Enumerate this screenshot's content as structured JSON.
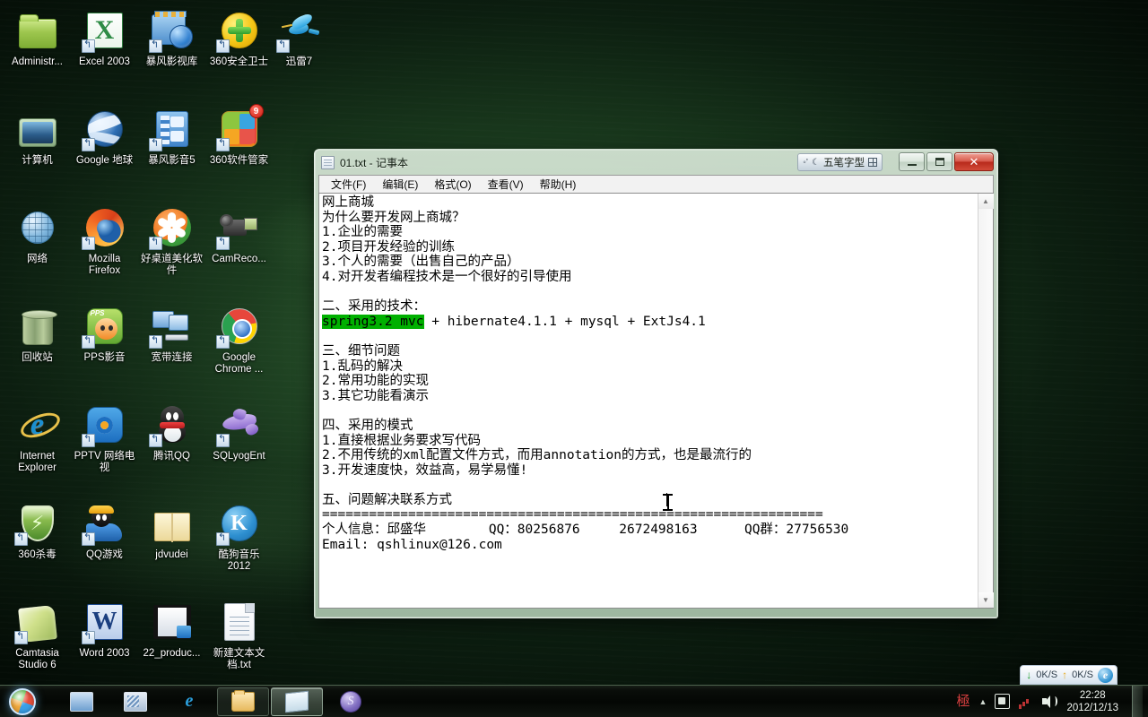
{
  "desktop": {
    "icons": [
      {
        "label": "Administr...",
        "art": "folder-green",
        "shortcut": false
      },
      {
        "label": "Excel 2003",
        "art": "excel",
        "shortcut": true
      },
      {
        "label": "暴风影视库",
        "art": "stormlib",
        "shortcut": true
      },
      {
        "label": "360安全卫士",
        "art": "s360guard",
        "shortcut": true
      },
      {
        "label": "迅雷7",
        "art": "thunder",
        "shortcut": true
      },
      {
        "label": "计算机",
        "art": "computer",
        "shortcut": false
      },
      {
        "label": "Google 地球",
        "art": "googleearth",
        "shortcut": true
      },
      {
        "label": "暴风影音5",
        "art": "stormplayer",
        "shortcut": true
      },
      {
        "label": "360软件管家",
        "art": "s360soft",
        "shortcut": true,
        "badge": "9"
      },
      {
        "label": "网络",
        "art": "network",
        "shortcut": false
      },
      {
        "label": "Mozilla Firefox",
        "art": "firefox",
        "shortcut": true
      },
      {
        "label": "好桌道美化软件",
        "art": "haozhuodao",
        "shortcut": true
      },
      {
        "label": "CamReco...",
        "art": "camrecorder",
        "shortcut": true
      },
      {
        "label": "回收站",
        "art": "recyclebin",
        "shortcut": false
      },
      {
        "label": "PPS影音",
        "art": "pps",
        "shortcut": true
      },
      {
        "label": "宽带连接",
        "art": "broadband",
        "shortcut": true
      },
      {
        "label": "Google Chrome ...",
        "art": "chrome",
        "shortcut": true
      },
      {
        "label": "Internet Explorer",
        "art": "ie",
        "shortcut": false
      },
      {
        "label": "PPTV 网络电视",
        "art": "pptv",
        "shortcut": true
      },
      {
        "label": "腾讯QQ",
        "art": "qq",
        "shortcut": true
      },
      {
        "label": "SQLyogEnt",
        "art": "sqlyog",
        "shortcut": true
      },
      {
        "label": "360杀毒",
        "art": "s360av",
        "shortcut": true
      },
      {
        "label": "QQ游戏",
        "art": "qqgame",
        "shortcut": true
      },
      {
        "label": "jdvudei",
        "art": "folder-manila",
        "shortcut": false
      },
      {
        "label": "酷狗音乐 2012",
        "art": "kugou",
        "shortcut": true
      },
      {
        "label": "Camtasia Studio 6",
        "art": "camtasia",
        "shortcut": true
      },
      {
        "label": "Word 2003",
        "art": "word",
        "shortcut": true
      },
      {
        "label": "22_produc...",
        "art": "videofile",
        "shortcut": false
      },
      {
        "label": "新建文本文档.txt",
        "art": "txtfile",
        "shortcut": false
      }
    ]
  },
  "notepad": {
    "title": "01.txt - 记事本",
    "icon_name": "notepad-document-icon",
    "menu": [
      "文件(F)",
      "编辑(E)",
      "格式(O)",
      "查看(V)",
      "帮助(H)"
    ],
    "ime": {
      "label": "五笔字型",
      "glyph_left": "◦’",
      "glyph_moon": "☾",
      "glyph_box": "keyboard-icon"
    },
    "window_buttons": {
      "minimize": "minimize",
      "maximize": "maximize",
      "close": "✕"
    },
    "content": {
      "before": "网上商城\n为什么要开发网上商城？\n1.企业的需要\n2.项目开发经验的训练\n3.个人的需要（出售自己的产品）\n4.对开发者编程技术是一个很好的引导使用\n\n二、采用的技术：\n",
      "selected": "spring3.2 mvc",
      "after": " + hibernate4.1.1 + mysql + ExtJs4.1\n\n三、细节问题\n1.乱码的解决\n2.常用功能的实现\n3.其它功能看演示\n\n四、采用的模式\n1.直接根据业务要求写代码\n2.不用传统的xml配置文件方式，而用annotation的方式，也是最流行的\n3.开发速度快，效益高，易学易懂!\n\n五、问题解决联系方式\n================================================================\n个人信息：邱盛华        QQ：80256876     2672498163      QQ群：27756530\nEmail: qshlinux@126.com"
    },
    "scrollbar": {
      "up": "▲",
      "down": "▼"
    }
  },
  "taskbar": {
    "start_label": "start-orb",
    "buttons": [
      {
        "name": "tb-show-desktop",
        "icon": "desktop-preview-icon",
        "state": "normal"
      },
      {
        "name": "tb-window-switcher",
        "icon": "flip3d-icon",
        "state": "normal"
      },
      {
        "name": "tb-internet-explorer",
        "icon": "ie-icon",
        "state": "normal",
        "glyph": "e"
      },
      {
        "name": "tb-windows-explorer",
        "icon": "folder-icon",
        "state": "grouped"
      },
      {
        "name": "tb-notepad",
        "icon": "notepad-icon",
        "state": "active"
      },
      {
        "name": "tb-sqlyog",
        "icon": "sqlyog-icon",
        "state": "normal",
        "glyph": "S"
      }
    ],
    "netspeed": {
      "down_arrow": "↓",
      "down_value": "0K/S",
      "up_arrow": "↑",
      "up_value": "0K/S",
      "browser_glyph": "e"
    },
    "tray": {
      "ime_glyph": "極",
      "chevron": "▲",
      "icons": [
        "safe-removal-icon",
        "network-icon",
        "volume-icon"
      ]
    },
    "clock": {
      "time": "22:28",
      "date": "2012/12/13"
    }
  },
  "colors": {
    "selection_green": "#00b000",
    "taskbar_dark": "#060a06",
    "desktop_green": "#1e4222",
    "close_button_red": "#c0392b"
  }
}
